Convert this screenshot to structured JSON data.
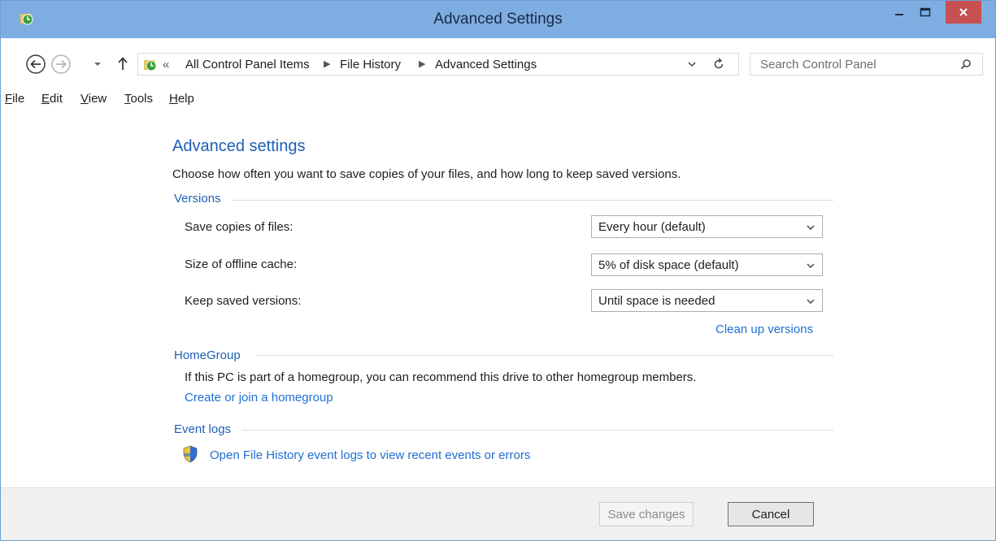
{
  "window": {
    "title": "Advanced Settings",
    "icons": {
      "app": "file-history-icon",
      "minimize": "minimize-icon",
      "maximize": "maximize-icon",
      "close": "close-icon"
    }
  },
  "address_bar": {
    "overflow": "«",
    "breadcrumbs": [
      "All Control Panel Items",
      "File History",
      "Advanced Settings"
    ],
    "search_placeholder": "Search Control Panel"
  },
  "menu": {
    "items": [
      {
        "accel": "F",
        "rest": "ile"
      },
      {
        "accel": "E",
        "rest": "dit"
      },
      {
        "accel": "V",
        "rest": "iew"
      },
      {
        "accel": "T",
        "rest": "ools"
      },
      {
        "accel": "H",
        "rest": "elp"
      }
    ]
  },
  "page": {
    "title": "Advanced settings",
    "subtitle": "Choose how often you want to save copies of your files, and how long to keep saved versions."
  },
  "versions": {
    "heading": "Versions",
    "save_copies_label": "Save copies of files:",
    "save_copies_value": "Every hour (default)",
    "cache_label": "Size of offline cache:",
    "cache_value": "5% of disk space (default)",
    "keep_label": "Keep saved versions:",
    "keep_value": "Until space is needed",
    "cleanup_link": "Clean up versions"
  },
  "homegroup": {
    "heading": "HomeGroup",
    "text": "If this PC is part of a homegroup, you can recommend this drive to other homegroup members.",
    "link": "Create or join a homegroup"
  },
  "event_logs": {
    "heading": "Event logs",
    "link": "Open File History event logs to view recent events or errors"
  },
  "footer": {
    "save_label": "Save changes",
    "cancel_label": "Cancel"
  },
  "colors": {
    "titlebar": "#7eaee1",
    "close_button": "#c75050",
    "heading_blue": "#1e5fb4",
    "link_blue": "#1e6fd4"
  }
}
